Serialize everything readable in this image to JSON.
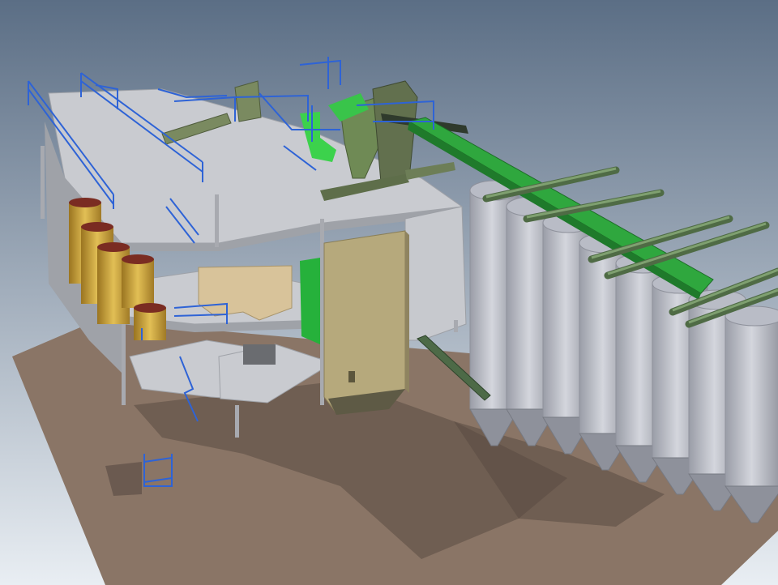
{
  "scene": {
    "name": "plant-3d-model-view",
    "colors": {
      "sky_top": "#5b6e85",
      "sky_bottom": "#e9eef3",
      "ground": "#8a7566",
      "ground_dark": "#6e5a4f",
      "shadow": "#5a4a42",
      "steel_floor": "#c9cbd0",
      "steel_floor_dark": "#9fa2a8",
      "railing": "#2e63d6",
      "silo": "#b9bcc6",
      "silo_dark": "#8e919b",
      "conveyor_green": "#2eaa3c",
      "conveyor_dark": "#4f6b45",
      "equipment_olive": "#7d8f62",
      "tower_khaki": "#b7aa7c",
      "tank_gold": "#c8a23a",
      "hopper_beige": "#d8c39a",
      "flange_red": "#7a2c22"
    }
  }
}
